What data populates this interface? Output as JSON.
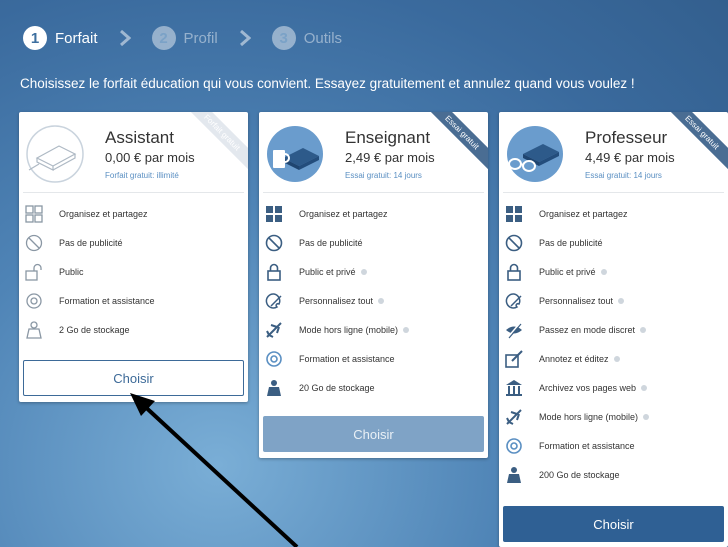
{
  "steps": [
    {
      "num": "1",
      "label": "Forfait",
      "state": "active"
    },
    {
      "num": "2",
      "label": "Profil",
      "state": "inactive"
    },
    {
      "num": "3",
      "label": "Outils",
      "state": "inactive"
    }
  ],
  "intro": "Choisissez le forfait éducation qui vous convient. Essayez gratuitement et annulez quand vous voulez !",
  "plans": [
    {
      "name": "Assistant",
      "price": "0,00 € par mois",
      "trial": "Forfait gratuit: illimité",
      "ribbon": "Forfait gratuit",
      "button": "Choisir",
      "features": [
        {
          "icon": "organize-icon",
          "label": "Organisez et partagez"
        },
        {
          "icon": "no-ads-icon",
          "label": "Pas de publicité"
        },
        {
          "icon": "unlock-icon",
          "label": "Public"
        },
        {
          "icon": "support-icon",
          "label": "Formation et assistance"
        },
        {
          "icon": "storage-icon",
          "label": "2 Go de stockage"
        }
      ]
    },
    {
      "name": "Enseignant",
      "price": "2,49 € par mois",
      "trial": "Essai gratuit: 14 jours",
      "ribbon": "Essai gratuit",
      "button": "Choisir",
      "features": [
        {
          "icon": "organize-icon",
          "label": "Organisez et partagez"
        },
        {
          "icon": "no-ads-icon",
          "label": "Pas de publicité"
        },
        {
          "icon": "lock-icon",
          "label": "Public et privé"
        },
        {
          "icon": "palette-icon",
          "label": "Personnalisez tout"
        },
        {
          "icon": "airplane-icon",
          "label": "Mode hors ligne (mobile)"
        },
        {
          "icon": "support-icon",
          "label": "Formation et assistance"
        },
        {
          "icon": "storage-icon",
          "label": "20 Go de stockage"
        }
      ]
    },
    {
      "name": "Professeur",
      "price": "4,49 € par mois",
      "trial": "Essai gratuit: 14 jours",
      "ribbon": "Essai gratuit",
      "button": "Choisir",
      "features": [
        {
          "icon": "organize-icon",
          "label": "Organisez et partagez"
        },
        {
          "icon": "no-ads-icon",
          "label": "Pas de publicité"
        },
        {
          "icon": "lock-icon",
          "label": "Public et privé"
        },
        {
          "icon": "palette-icon",
          "label": "Personnalisez tout"
        },
        {
          "icon": "hidden-eye-icon",
          "label": "Passez en mode discret"
        },
        {
          "icon": "annotate-icon",
          "label": "Annotez et éditez"
        },
        {
          "icon": "archive-icon",
          "label": "Archivez vos pages web"
        },
        {
          "icon": "airplane-icon",
          "label": "Mode hors ligne (mobile)"
        },
        {
          "icon": "support-icon",
          "label": "Formation et assistance"
        },
        {
          "icon": "storage-icon",
          "label": "200 Go de stockage"
        }
      ]
    }
  ],
  "colors": {
    "accent": "#2f6094",
    "link": "#5a8fc2",
    "background": "#4f84b6"
  }
}
